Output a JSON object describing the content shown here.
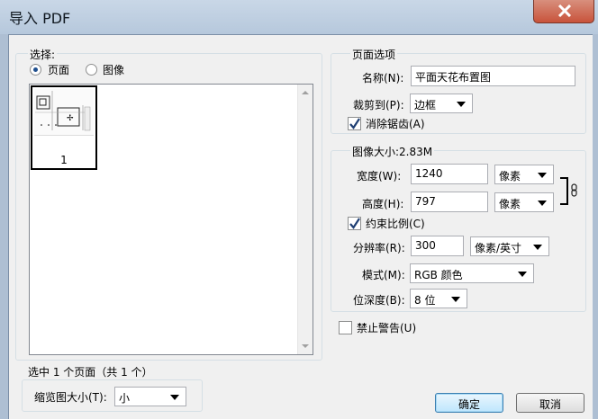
{
  "window": {
    "title": "导入 PDF",
    "close_icon": "close-icon"
  },
  "select": {
    "legend": "选择:",
    "radio_page": "页面",
    "radio_image": "图像",
    "selected_option": "页面",
    "thumbnails": [
      {
        "page": "1"
      }
    ],
    "status": "选中 1 个页面（共 1 个）",
    "thumb_size_label": "缩览图大小(T):",
    "thumb_size_value": "小"
  },
  "page_options": {
    "legend": "页面选项",
    "name_label": "名称(N):",
    "name_value": "平面天花布置图",
    "crop_label": "裁剪到(P):",
    "crop_value": "边框",
    "antialias_label": "消除锯齿(A)",
    "antialias_checked": true
  },
  "image_size": {
    "legend": "图像大小:2.83M",
    "width_label": "宽度(W):",
    "width_value": "1240",
    "width_unit": "像素",
    "height_label": "高度(H):",
    "height_value": "797",
    "height_unit": "像素",
    "link_icon": "chain-link-icon",
    "constrain_label": "约束比例(C)",
    "constrain_checked": true,
    "resolution_label": "分辨率(R):",
    "resolution_value": "300",
    "resolution_unit": "像素/英寸",
    "mode_label": "模式(M):",
    "mode_value": "RGB 颜色",
    "depth_label": "位深度(B):",
    "depth_value": "8 位"
  },
  "suppress_warnings": {
    "label": "禁止警告(U)",
    "checked": false
  },
  "buttons": {
    "ok": "确定",
    "cancel": "取消"
  },
  "colors": {
    "titlebar": "#b6c8dc",
    "close_button": "#c8533b",
    "dialog_bg": "#f0f0f0",
    "checkbox_check": "#1f3f73",
    "default_button": "#bee6fd"
  }
}
